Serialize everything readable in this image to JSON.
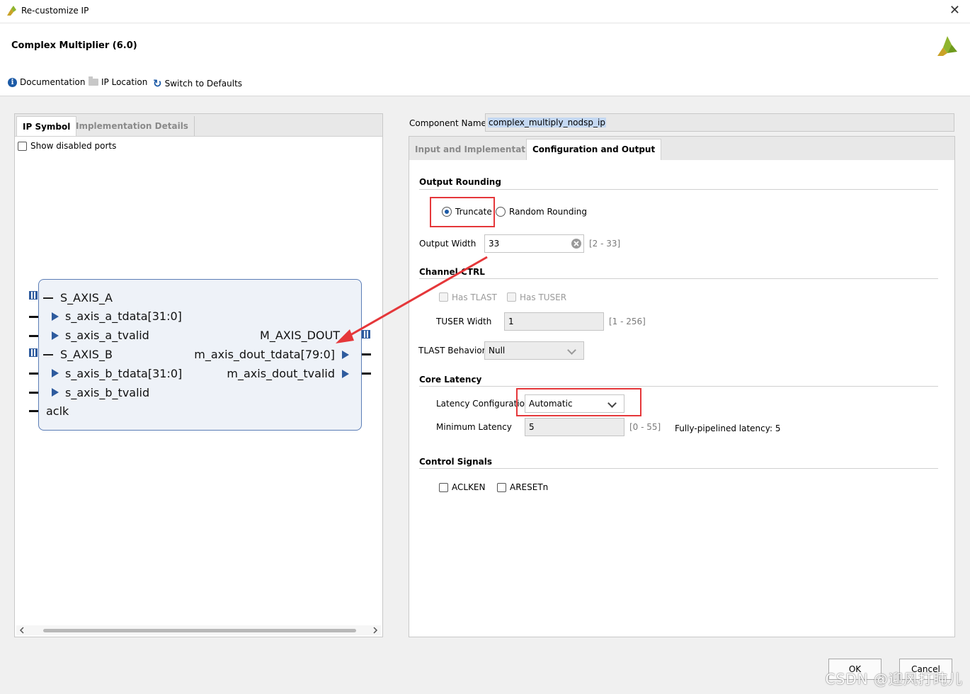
{
  "window": {
    "title": "Re-customize IP",
    "close_symbol": "✕"
  },
  "header": {
    "ip_title": "Complex Multiplier (6.0)"
  },
  "toolbar": {
    "documentation": "Documentation",
    "ip_location": "IP Location",
    "switch_defaults": "Switch to Defaults"
  },
  "left_tabs": {
    "ip_symbol": "IP Symbol",
    "implementation_details": "Implementation Details"
  },
  "show_disabled_ports": "Show disabled ports",
  "ip_symbol": {
    "s_axis_a": "S_AXIS_A",
    "s_axis_a_tdata": "s_axis_a_tdata[31:0]",
    "s_axis_a_tvalid": "s_axis_a_tvalid",
    "s_axis_b": "S_AXIS_B",
    "s_axis_b_tdata": "s_axis_b_tdata[31:0]",
    "s_axis_b_tvalid": "s_axis_b_tvalid",
    "aclk": "aclk",
    "m_axis_dout": "M_AXIS_DOUT",
    "m_axis_dout_tdata": "m_axis_dout_tdata[79:0]",
    "m_axis_dout_tvalid": "m_axis_dout_tvalid"
  },
  "component": {
    "label": "Component Name",
    "value": "complex_multiply_nodsp_ip"
  },
  "right_tabs": {
    "input_impl": "Input and Implementation",
    "config_output": "Configuration and Output"
  },
  "output_rounding": {
    "heading": "Output Rounding",
    "truncate": "Truncate",
    "random": "Random Rounding",
    "selected": "Truncate",
    "width_label": "Output Width",
    "width_value": "33",
    "width_range": "[2 - 33]"
  },
  "channel_ctrl": {
    "heading": "Channel CTRL",
    "has_tlast": "Has TLAST",
    "has_tuser": "Has TUSER",
    "tuser_width_label": "TUSER Width",
    "tuser_width_value": "1",
    "tuser_range": "[1 - 256]",
    "tlast_behavior_label": "TLAST Behavior",
    "tlast_behavior_value": "Null"
  },
  "core_latency": {
    "heading": "Core Latency",
    "config_label": "Latency Configuration",
    "config_value": "Automatic",
    "min_label": "Minimum Latency",
    "min_value": "5",
    "min_range": "[0 - 55]",
    "pipelined": "Fully-pipelined latency: 5"
  },
  "control_signals": {
    "heading": "Control Signals",
    "aclken": "ACLKEN",
    "aresetn": "ARESETn"
  },
  "buttons": {
    "ok": "OK",
    "cancel": "Cancel"
  },
  "watermark": "CSDN @迎风打盹儿",
  "colors": {
    "accent": "#1c5aa6",
    "highlight": "#e5373a",
    "symbol_fill": "#eef2f8"
  }
}
